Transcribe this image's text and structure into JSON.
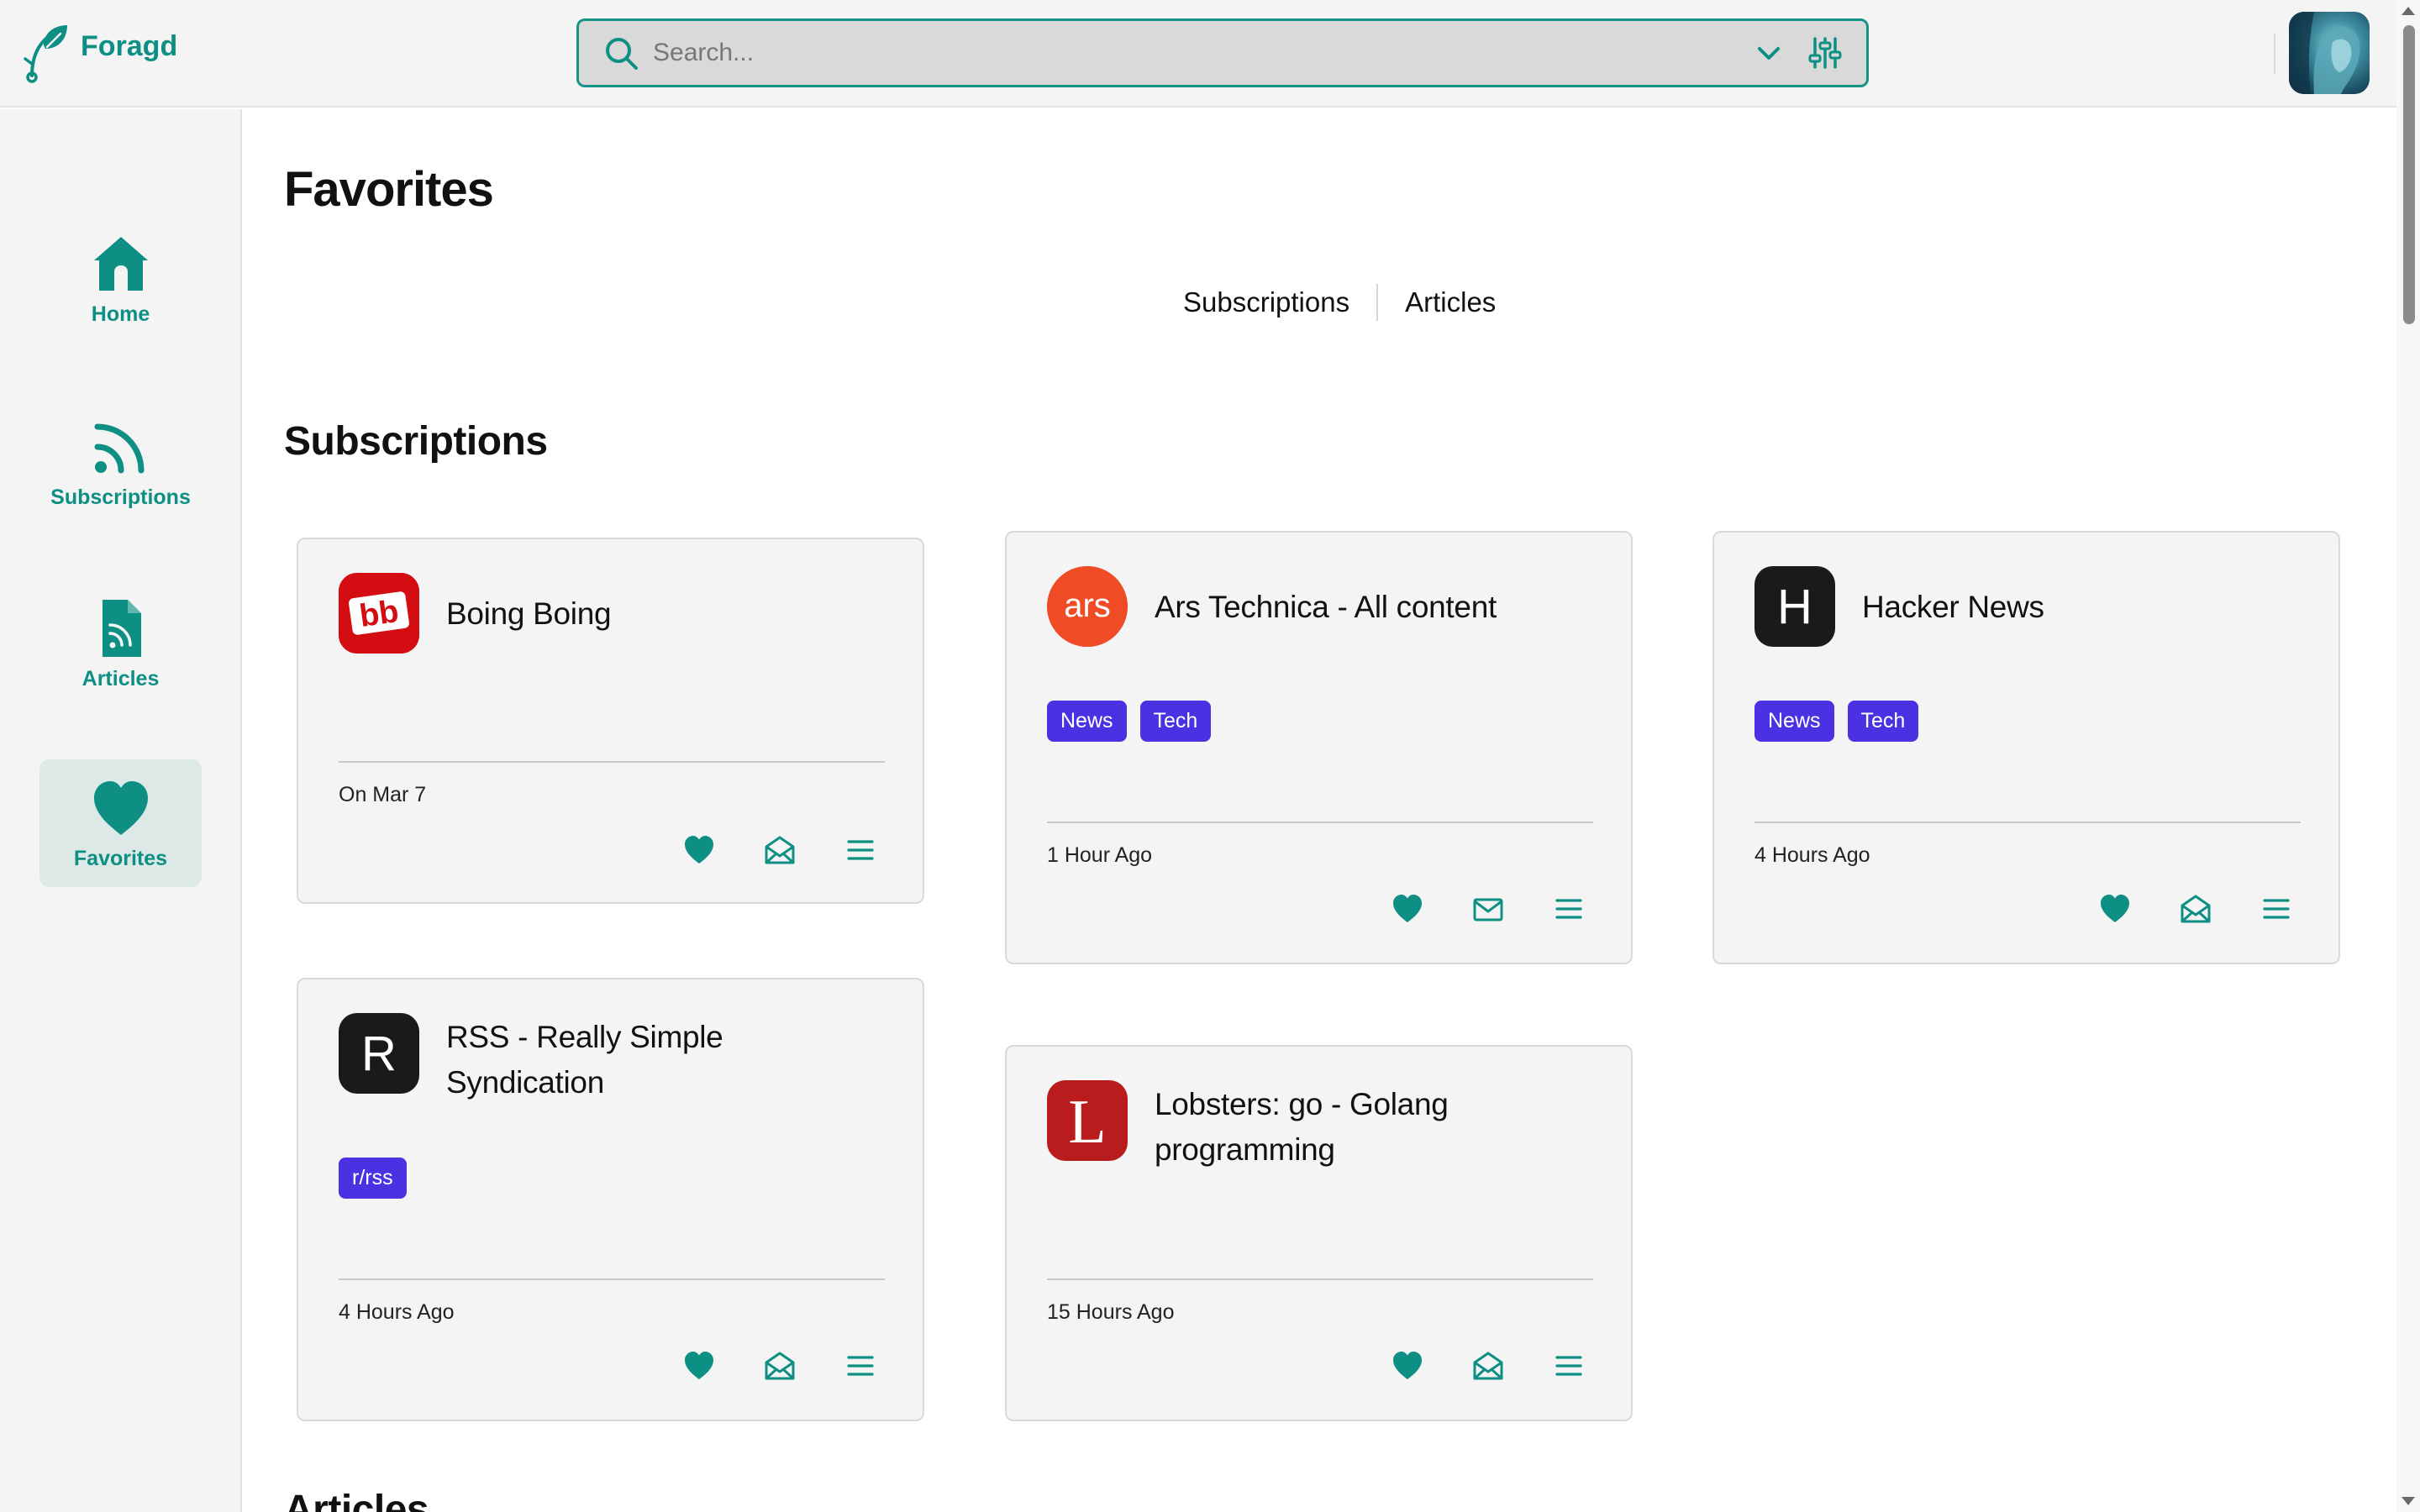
{
  "app": {
    "name": "Foragd",
    "accent": "#0d8f83",
    "tag_color": "#4a32e3"
  },
  "search": {
    "placeholder": "Search...",
    "icons": [
      "search-icon",
      "chevron-down-icon",
      "sliders-icon"
    ]
  },
  "sidebar": {
    "items": [
      {
        "label": "Home",
        "icon": "home-icon",
        "active": false
      },
      {
        "label": "Subscriptions",
        "icon": "rss-icon",
        "active": false
      },
      {
        "label": "Articles",
        "icon": "article-icon",
        "active": false
      },
      {
        "label": "Favorites",
        "icon": "heart-icon",
        "active": true
      }
    ]
  },
  "main": {
    "title": "Favorites",
    "tabs": [
      {
        "label": "Subscriptions"
      },
      {
        "label": "Articles"
      }
    ],
    "subscriptions_heading": "Subscriptions",
    "articles_heading": "Articles"
  },
  "cards": [
    {
      "title": "Boing Boing",
      "logo_text": "bb",
      "logo_color": "#d40d12",
      "tags": [],
      "time": "On Mar 7",
      "mail_icon": "mail-open-icon"
    },
    {
      "title": "Ars Technica - All content",
      "logo_text": "ars",
      "logo_color": "#ef4b24",
      "tags": [
        "News",
        "Tech"
      ],
      "time": "1 Hour Ago",
      "mail_icon": "mail-icon"
    },
    {
      "title": "Hacker News",
      "logo_text": "H",
      "logo_color": "#1a1a1a",
      "tags": [
        "News",
        "Tech"
      ],
      "time": "4 Hours Ago",
      "mail_icon": "mail-open-icon"
    },
    {
      "title": "RSS - Really Simple Syndication",
      "logo_text": "R",
      "logo_color": "#1a1a1a",
      "tags": [
        "r/rss"
      ],
      "time": "4 Hours Ago",
      "mail_icon": "mail-open-icon"
    },
    {
      "title": "Lobsters: go - Golang programming",
      "logo_text": "L",
      "logo_color": "#b81c1c",
      "tags": [],
      "time": "15 Hours Ago",
      "mail_icon": "mail-open-icon"
    }
  ]
}
